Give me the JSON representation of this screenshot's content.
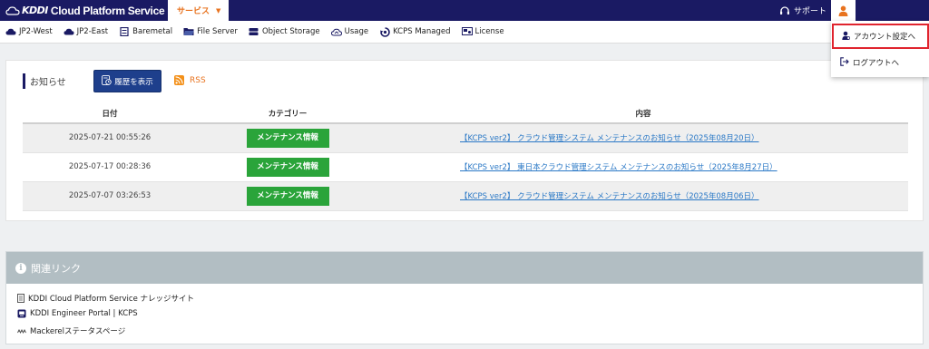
{
  "header": {
    "brand_kddi": "KDDI",
    "brand_rest": "Cloud Platform Service",
    "services_tab": "サービス",
    "support": "サポート"
  },
  "nav": [
    {
      "label": "JP2-West",
      "icon": "cloud-icon"
    },
    {
      "label": "JP2-East",
      "icon": "cloud-icon"
    },
    {
      "label": "Baremetal",
      "icon": "server-icon"
    },
    {
      "label": "File Server",
      "icon": "folder-icon"
    },
    {
      "label": "Object Storage",
      "icon": "storage-icon"
    },
    {
      "label": "Usage",
      "icon": "usage-icon"
    },
    {
      "label": "KCPS Managed",
      "icon": "managed-icon"
    },
    {
      "label": "License",
      "icon": "license-icon"
    }
  ],
  "user_menu": {
    "account_settings": "アカウント設定へ",
    "logout": "ログアウトへ"
  },
  "notices": {
    "title": "お知らせ",
    "history_button": "履歴を表示",
    "rss": "RSS",
    "columns": [
      "日付",
      "カテゴリー",
      "内容"
    ],
    "rows": [
      {
        "date": "2025-07-21 00:55:26",
        "category": "メンテナンス情報",
        "content": "【KCPS ver2】 クラウド管理システム メンテナンスのお知らせ（2025年08月20日）"
      },
      {
        "date": "2025-07-17 00:28:36",
        "category": "メンテナンス情報",
        "content": "【KCPS ver2】 東日本クラウド管理システム メンテナンスのお知らせ（2025年8月27日）"
      },
      {
        "date": "2025-07-07 03:26:53",
        "category": "メンテナンス情報",
        "content": "【KCPS ver2】 クラウド管理システム メンテナンスのお知らせ（2025年08月06日）"
      }
    ]
  },
  "related": {
    "title": "関連リンク",
    "links": [
      {
        "label": "KDDI Cloud Platform Service ナレッジサイト",
        "icon": "document-icon"
      },
      {
        "label": "KDDI Engineer Portal | KCPS",
        "icon": "portal-icon"
      },
      {
        "label": "Mackerelステータスページ",
        "icon": "wave-icon"
      }
    ]
  },
  "colors": {
    "header_bg": "#1a1a63",
    "accent_orange": "#e8731f",
    "category_green": "#2aa43a",
    "link_blue": "#2a78c6",
    "highlight_red": "#e0242e"
  }
}
